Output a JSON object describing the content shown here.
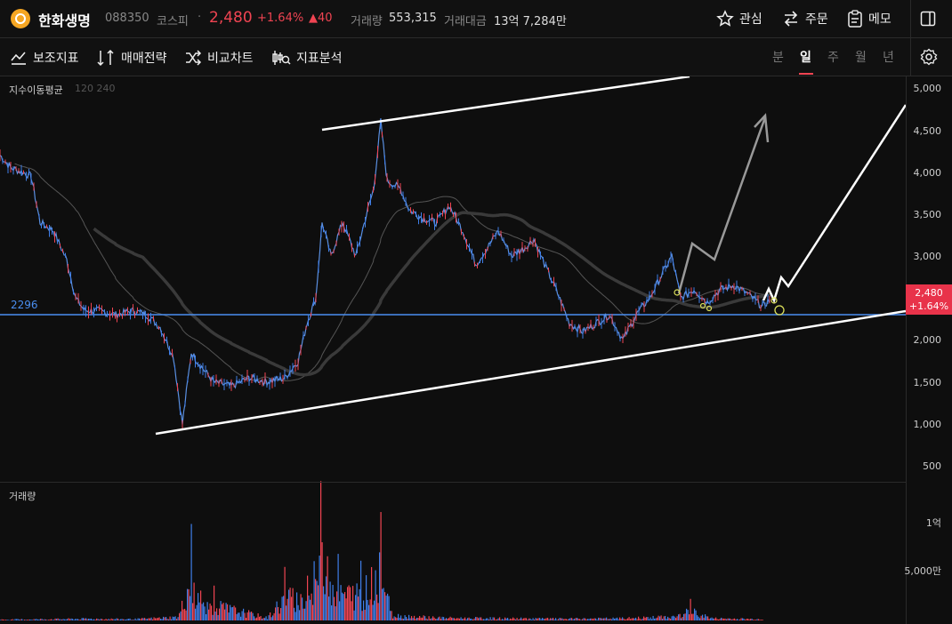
{
  "header": {
    "name": "한화생명",
    "code": "088350",
    "market": "코스피",
    "separator": "·",
    "price": "2,480",
    "change_pct": "+1.64%",
    "change_abs": "▲40",
    "volume_label": "거래량",
    "volume_value": "553,315",
    "amount_label": "거래대금",
    "amount_value": "13억 7,284만",
    "watch_label": "관심",
    "order_label": "주문",
    "memo_label": "메모"
  },
  "toolbar": {
    "indicator_label": "보조지표",
    "strategy_label": "매매전략",
    "compare_label": "비교차트",
    "analysis_label": "지표분석",
    "periods": [
      "분",
      "일",
      "주",
      "월",
      "년"
    ],
    "active_period": "일"
  },
  "chart": {
    "indicator_name": "지수이동평균",
    "indicator_params": "120 240",
    "hline_value": "2296",
    "y_ticks": [
      "5,000",
      "4,500",
      "4,000",
      "3,500",
      "3,000",
      "2,500",
      "2,000",
      "1,500",
      "1,000",
      "500"
    ],
    "price_tag_price": "2,480",
    "price_tag_pct": "+1.64%",
    "volume_label": "거래량",
    "volume_ticks": [
      "1억",
      "5,000만"
    ],
    "colors": {
      "up": "#f04452",
      "down": "#3f7ee8",
      "hline": "#4a8ef0",
      "background": "#0e0e0e"
    }
  },
  "chart_data": {
    "type": "line",
    "y_ticks": [
      5000,
      4500,
      4000,
      3500,
      3000,
      2500,
      2000,
      1500,
      1000,
      500
    ],
    "last_price": 2480,
    "horizontal_line": 2296,
    "price_path": [
      [
        0,
        4200
      ],
      [
        12,
        4050
      ],
      [
        25,
        4000
      ],
      [
        35,
        3950
      ],
      [
        45,
        3400
      ],
      [
        60,
        3300
      ],
      [
        75,
        2950
      ],
      [
        85,
        2500
      ],
      [
        95,
        2350
      ],
      [
        110,
        2350
      ],
      [
        130,
        2300
      ],
      [
        150,
        2350
      ],
      [
        165,
        2300
      ],
      [
        180,
        2150
      ],
      [
        195,
        1800
      ],
      [
        205,
        1000
      ],
      [
        215,
        1850
      ],
      [
        225,
        1700
      ],
      [
        240,
        1500
      ],
      [
        260,
        1450
      ],
      [
        280,
        1550
      ],
      [
        300,
        1500
      ],
      [
        320,
        1550
      ],
      [
        335,
        1750
      ],
      [
        345,
        2200
      ],
      [
        355,
        2500
      ],
      [
        362,
        3400
      ],
      [
        372,
        3000
      ],
      [
        385,
        3400
      ],
      [
        400,
        3000
      ],
      [
        412,
        3500
      ],
      [
        420,
        3800
      ],
      [
        428,
        4600
      ],
      [
        435,
        3900
      ],
      [
        450,
        3800
      ],
      [
        460,
        3550
      ],
      [
        475,
        3450
      ],
      [
        490,
        3400
      ],
      [
        505,
        3600
      ],
      [
        520,
        3300
      ],
      [
        535,
        2900
      ],
      [
        548,
        3100
      ],
      [
        560,
        3300
      ],
      [
        575,
        3000
      ],
      [
        590,
        3100
      ],
      [
        600,
        3200
      ],
      [
        612,
        2900
      ],
      [
        625,
        2600
      ],
      [
        640,
        2200
      ],
      [
        655,
        2100
      ],
      [
        670,
        2200
      ],
      [
        685,
        2300
      ],
      [
        700,
        2000
      ],
      [
        715,
        2300
      ],
      [
        730,
        2500
      ],
      [
        745,
        2800
      ],
      [
        755,
        3000
      ],
      [
        765,
        2500
      ],
      [
        780,
        2600
      ],
      [
        795,
        2450
      ],
      [
        810,
        2600
      ],
      [
        825,
        2650
      ],
      [
        840,
        2550
      ],
      [
        857,
        2400
      ],
      [
        865,
        2480
      ]
    ],
    "volume_path": [
      [
        0,
        2
      ],
      [
        50,
        3
      ],
      [
        100,
        4
      ],
      [
        150,
        3
      ],
      [
        200,
        8
      ],
      [
        215,
        100
      ],
      [
        225,
        30
      ],
      [
        240,
        35
      ],
      [
        300,
        6
      ],
      [
        320,
        55
      ],
      [
        345,
        45
      ],
      [
        360,
        140
      ],
      [
        380,
        65
      ],
      [
        405,
        60
      ],
      [
        428,
        110
      ],
      [
        440,
        12
      ],
      [
        500,
        6
      ],
      [
        560,
        5
      ],
      [
        640,
        4
      ],
      [
        700,
        5
      ],
      [
        760,
        9
      ],
      [
        775,
        22
      ],
      [
        800,
        5
      ],
      [
        857,
        3
      ]
    ]
  }
}
